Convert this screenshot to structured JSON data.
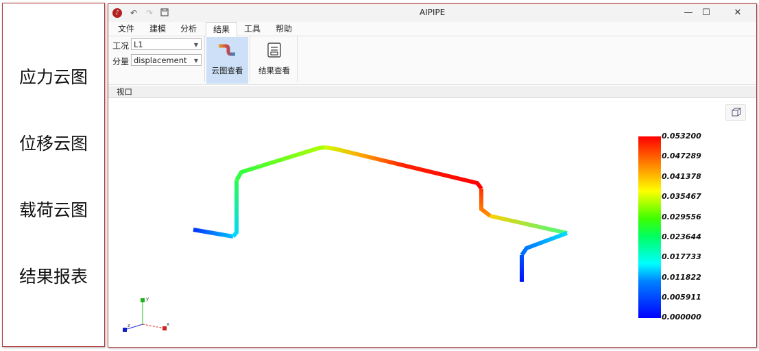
{
  "side_panel": {
    "labels": [
      "应力云图",
      "位移云图",
      "载荷云图",
      "结果报表"
    ]
  },
  "window": {
    "title": "AIPIPE",
    "undo_icon": "undo-icon",
    "redo_icon": "redo-icon",
    "save_icon": "save-icon",
    "minimize": "—",
    "maximize": "☐",
    "close": "✕"
  },
  "menu": {
    "items": [
      "文件",
      "建模",
      "分析",
      "结果",
      "工具",
      "帮助"
    ],
    "active": "结果"
  },
  "ribbon": {
    "case_label": "工况",
    "case_value": "L1",
    "component_label": "分量",
    "component_value": "displacement",
    "buttons": [
      {
        "label": "云图查看",
        "icon": "pipe-contour-icon",
        "active": true
      },
      {
        "label": "结果查看",
        "icon": "result-report-icon",
        "active": false
      }
    ]
  },
  "viewport": {
    "title": "视口",
    "view_cube_icon": "view-cube-icon",
    "axis_labels": {
      "x": "x",
      "y": "y",
      "z": "z"
    }
  },
  "colorbar": {
    "ticks": [
      "0.053200",
      "0.047289",
      "0.041378",
      "0.035467",
      "0.029556",
      "0.023644",
      "0.017733",
      "0.011822",
      "0.005911",
      "0.000000"
    ],
    "colors": {
      "min": "#0000ff",
      "max": "#ff0000"
    }
  }
}
